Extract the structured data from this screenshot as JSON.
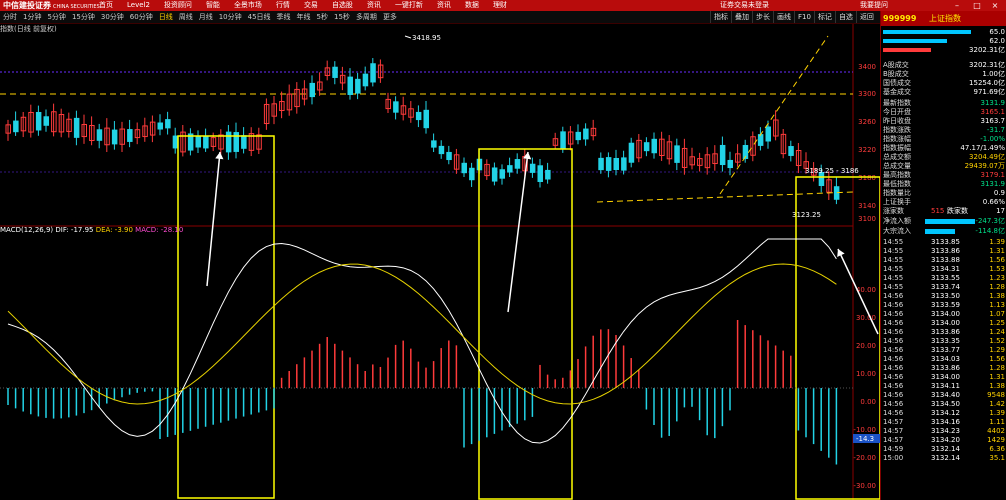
{
  "topbar": {
    "logo": "中信建投证券",
    "logo_sub": "CHINA SECURITIES",
    "menu": [
      "首页",
      "Level2",
      "投资顾问",
      "智能",
      "全景市场",
      "行情",
      "交易",
      "自选股",
      "资讯",
      "一键打新",
      "资讯",
      "数据",
      "理财"
    ],
    "center_text": "证券交易未登录",
    "right_text": "我要提问"
  },
  "periodbar": {
    "items": [
      "分时",
      "1分钟",
      "5分钟",
      "15分钟",
      "30分钟",
      "60分钟",
      "日线",
      "周线",
      "月线",
      "10分钟",
      "45日线",
      "季线",
      "年线",
      "5秒",
      "15秒",
      "多周期",
      "更多"
    ],
    "active": "日线",
    "right_tabs": [
      "指标",
      "叠加",
      "步长",
      "画线",
      "F10",
      "标记",
      "自选",
      "返回"
    ]
  },
  "chart": {
    "title": "指数(日线 前复权)",
    "annotations": {
      "high": "3418.95",
      "mid_right": "3189.25 - 3186",
      "low": "3123.25"
    },
    "price_axis": [
      "3400",
      "3300",
      "3260",
      "3220",
      "3180",
      "3140",
      "3100"
    ],
    "percent_axis": [
      "60.0%",
      "40.0%",
      "20.0%",
      "0.00%",
      "-20.0%",
      "-40.0%"
    ],
    "macd_axis": [
      "40.00",
      "30.00",
      "20.00",
      "10.00",
      "0.00",
      "-10.00",
      "-20.00",
      "-30.00"
    ],
    "macd_current": "-14.3",
    "macd_label": "MACD(12,26,9)",
    "dif": "DIF: -17.95",
    "dea": "DEA: -3.90",
    "macd_val": "MACD: -28.10"
  },
  "panel": {
    "code": "999999",
    "name": "上证指数",
    "top_values": [
      "65.0",
      "62.0",
      "3202.31亿"
    ],
    "market": [
      {
        "label": "A股成交",
        "value": "3202.31亿",
        "cls": "wh"
      },
      {
        "label": "B股成交",
        "value": "1.00亿",
        "cls": "wh"
      },
      {
        "label": "国债成交",
        "value": "15254.0亿",
        "cls": "wh"
      },
      {
        "label": "基金成交",
        "value": "971.69亿",
        "cls": "wh"
      }
    ],
    "quote": [
      {
        "label": "最新指数",
        "value": "3131.9",
        "cls": "dn"
      },
      {
        "label": "今日开盘",
        "value": "3165.1",
        "cls": "up"
      },
      {
        "label": "昨日收盘",
        "value": "3163.7",
        "cls": "wh"
      },
      {
        "label": "指数涨跌",
        "value": "-31.7",
        "cls": "dn"
      },
      {
        "label": "指数涨幅",
        "value": "-1.00%",
        "cls": "dn"
      },
      {
        "label": "指数振幅",
        "value": "47.17/1.49%",
        "cls": "wh"
      },
      {
        "label": "总成交额",
        "value": "3204.49亿",
        "cls": "yel"
      },
      {
        "label": "总成交量",
        "value": "29439.07万",
        "cls": "yel"
      },
      {
        "label": "最高指数",
        "value": "3179.1",
        "cls": "up"
      },
      {
        "label": "最低指数",
        "value": "3131.9",
        "cls": "dn"
      },
      {
        "label": "指数量比",
        "value": "0.9",
        "cls": "wh"
      },
      {
        "label": "上证换手",
        "value": "0.66%",
        "cls": "wh"
      }
    ],
    "updown": {
      "label": "涨家数",
      "value": "515",
      "label2": "跌家数",
      "value2": "17"
    },
    "flows": [
      {
        "label": "净流入额",
        "value": "-247.3亿",
        "cls": "dn"
      },
      {
        "label": "大宗流入",
        "value": "-114.8亿",
        "cls": "dn"
      }
    ],
    "ticks": [
      {
        "t": "14:55",
        "p": "3133.85",
        "v": "1.39"
      },
      {
        "t": "14:55",
        "p": "3133.86",
        "v": "1.31"
      },
      {
        "t": "14:55",
        "p": "3133.88",
        "v": "1.56"
      },
      {
        "t": "14:55",
        "p": "3134.31",
        "v": "1.53"
      },
      {
        "t": "14:55",
        "p": "3133.55",
        "v": "1.23"
      },
      {
        "t": "14:55",
        "p": "3133.74",
        "v": "1.28"
      },
      {
        "t": "14:56",
        "p": "3133.50",
        "v": "1.38"
      },
      {
        "t": "14:56",
        "p": "3133.59",
        "v": "1.13"
      },
      {
        "t": "14:56",
        "p": "3134.00",
        "v": "1.07"
      },
      {
        "t": "14:56",
        "p": "3134.00",
        "v": "1.25"
      },
      {
        "t": "14:56",
        "p": "3133.86",
        "v": "1.24"
      },
      {
        "t": "14:56",
        "p": "3133.35",
        "v": "1.52"
      },
      {
        "t": "14:56",
        "p": "3133.77",
        "v": "1.29"
      },
      {
        "t": "14:56",
        "p": "3134.03",
        "v": "1.56"
      },
      {
        "t": "14:56",
        "p": "3133.86",
        "v": "1.28"
      },
      {
        "t": "14:56",
        "p": "3134.00",
        "v": "1.31"
      },
      {
        "t": "14:56",
        "p": "3134.11",
        "v": "1.38"
      },
      {
        "t": "14:56",
        "p": "3134.40",
        "v": "9548"
      },
      {
        "t": "14:56",
        "p": "3134.50",
        "v": "1.42"
      },
      {
        "t": "14:56",
        "p": "3134.12",
        "v": "1.39"
      },
      {
        "t": "14:57",
        "p": "3134.16",
        "v": "1.11"
      },
      {
        "t": "14:57",
        "p": "3134.23",
        "v": "4402"
      },
      {
        "t": "14:57",
        "p": "3134.20",
        "v": "1429"
      },
      {
        "t": "14:59",
        "p": "3132.14",
        "v": "6.36"
      },
      {
        "t": "15:00",
        "p": "3132.14",
        "v": "35.1"
      }
    ]
  },
  "colors": {
    "up": "#ff3b3b",
    "down": "#22d3e6",
    "accent": "#ffd200",
    "grid": "#5a0000"
  }
}
